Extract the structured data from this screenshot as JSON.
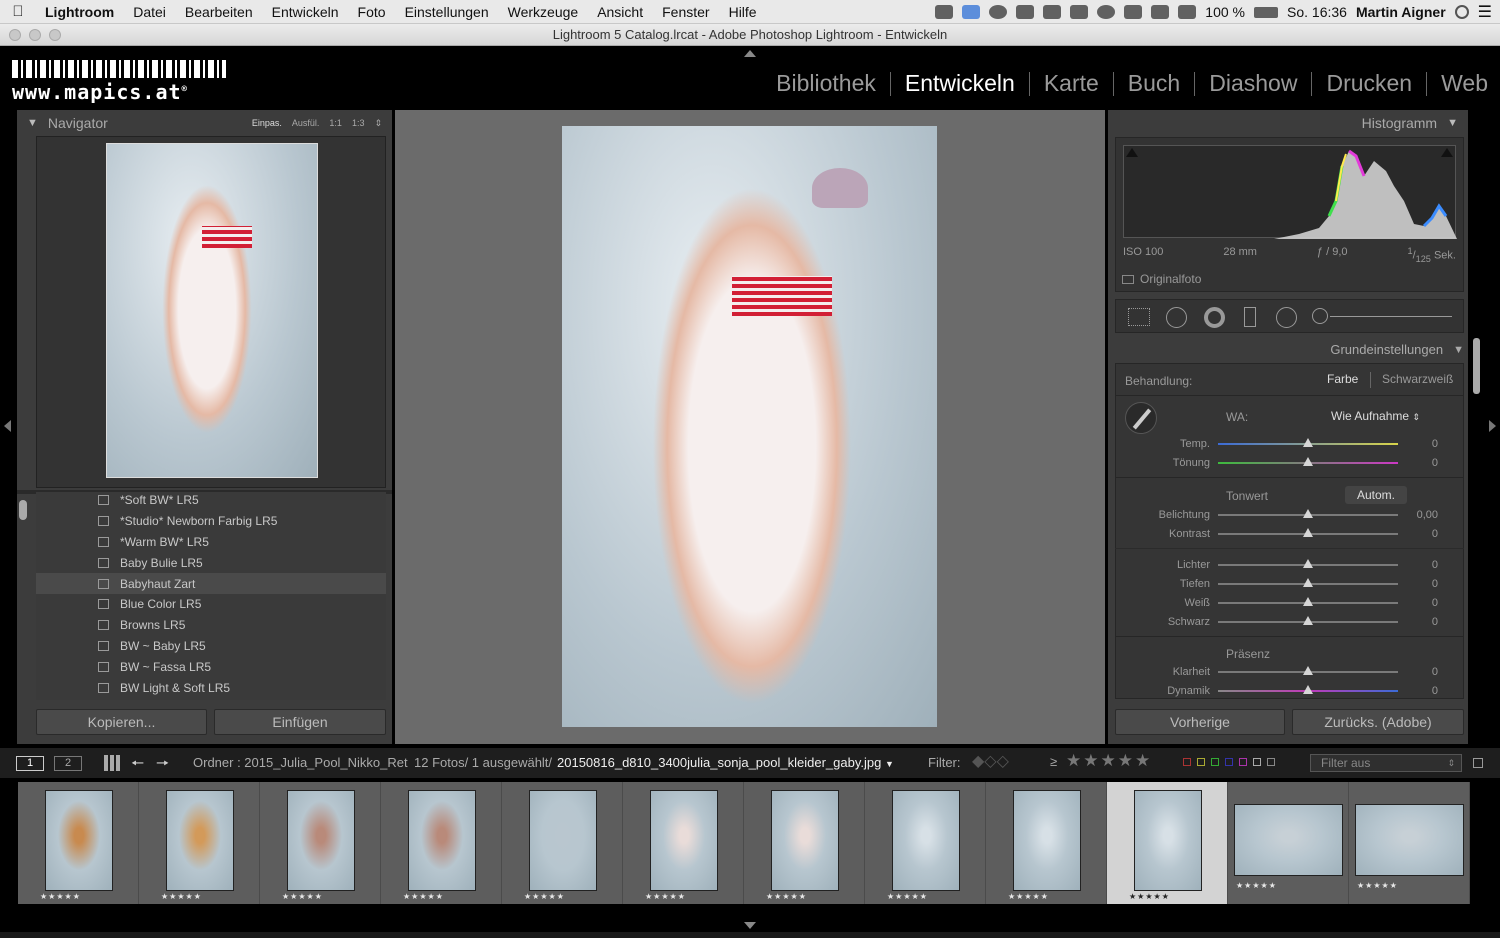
{
  "menubar": {
    "app": "Lightroom",
    "items": [
      "Datei",
      "Bearbeiten",
      "Entwickeln",
      "Foto",
      "Einstellungen",
      "Werkzeuge",
      "Ansicht",
      "Fenster",
      "Hilfe"
    ],
    "battery": "100 %",
    "clock": "So. 16:36",
    "user": "Martin Aigner"
  },
  "window": {
    "title": "Lightroom 5 Catalog.lrcat - Adobe Photoshop Lightroom - Entwickeln"
  },
  "logo": {
    "url": "www.mapics.at",
    "reg": "®"
  },
  "modules": [
    "Bibliothek",
    "Entwickeln",
    "Karte",
    "Buch",
    "Diashow",
    "Drucken",
    "Web"
  ],
  "navigator": {
    "title": "Navigator",
    "zoom": [
      "Einpas.",
      "Ausfül.",
      "1:1",
      "1:3"
    ]
  },
  "presets": [
    "*Soft BW* LR5",
    "*Studio* Newborn Farbig LR5",
    "*Warm BW* LR5",
    "Baby Bulie LR5",
    "Babyhaut Zart",
    "Blue Color LR5",
    "Browns LR5",
    "BW ~ Baby LR5",
    "BW ~ Fassa LR5",
    "BW Light & Soft LR5"
  ],
  "left_buttons": {
    "copy": "Kopieren...",
    "paste": "Einfügen"
  },
  "histogram": {
    "title": "Histogramm",
    "iso": "ISO 100",
    "focal": "28 mm",
    "aperture": "ƒ / 9,0",
    "shutter_num": "1",
    "shutter_den": "125",
    "shutter_unit": "Sek.",
    "original": "Originalfoto"
  },
  "basic": {
    "title": "Grundeinstellungen",
    "treatment_label": "Behandlung:",
    "color": "Farbe",
    "bw": "Schwarzweiß",
    "wb_label": "WA:",
    "wb_value": "Wie Aufnahme",
    "tone_label": "Tonwert",
    "auto": "Autom.",
    "presence_label": "Präsenz",
    "sliders": [
      {
        "label": "Temp.",
        "value": "0",
        "pos": 0.5
      },
      {
        "label": "Tönung",
        "value": "0",
        "pos": 0.5
      },
      {
        "label": "Belichtung",
        "value": "0,00",
        "pos": 0.5
      },
      {
        "label": "Kontrast",
        "value": "0",
        "pos": 0.5
      },
      {
        "label": "Lichter",
        "value": "0",
        "pos": 0.5
      },
      {
        "label": "Tiefen",
        "value": "0",
        "pos": 0.5
      },
      {
        "label": "Weiß",
        "value": "0",
        "pos": 0.5
      },
      {
        "label": "Schwarz",
        "value": "0",
        "pos": 0.5
      },
      {
        "label": "Klarheit",
        "value": "0",
        "pos": 0.5
      },
      {
        "label": "Dynamik",
        "value": "0",
        "pos": 0.5
      }
    ]
  },
  "right_buttons": {
    "prev": "Vorherige",
    "reset": "Zurücks. (Adobe)"
  },
  "filmbar": {
    "view1": "1",
    "view2": "2",
    "folder": "Ordner : 2015_Julia_Pool_Nikko_Ret",
    "count": "12 Fotos/  1 ausgewählt/",
    "filename": "20150816_d810_3400julia_sonja_pool_kleider_gaby.jpg",
    "filter_label": "Filter:",
    "rating_op": "≥",
    "stars": "★★★★★",
    "filter_off": "Filter aus"
  },
  "thumbnails": [
    {
      "stars": "★★★★★"
    },
    {
      "stars": "★★★★★"
    },
    {
      "stars": "★★★★★"
    },
    {
      "stars": "★★★★★"
    },
    {
      "stars": "★★★★★"
    },
    {
      "stars": "★★★★★"
    },
    {
      "stars": "★★★★★"
    },
    {
      "stars": "★★★★★"
    },
    {
      "stars": "★★★★★"
    },
    {
      "stars": "★★★★★"
    },
    {
      "stars": "★★★★★"
    },
    {
      "stars": "★★★★★"
    }
  ],
  "colors": {
    "accent_stripe": "#d21f35",
    "panel": "#3c3c3c",
    "center": "#6b6b6b"
  }
}
